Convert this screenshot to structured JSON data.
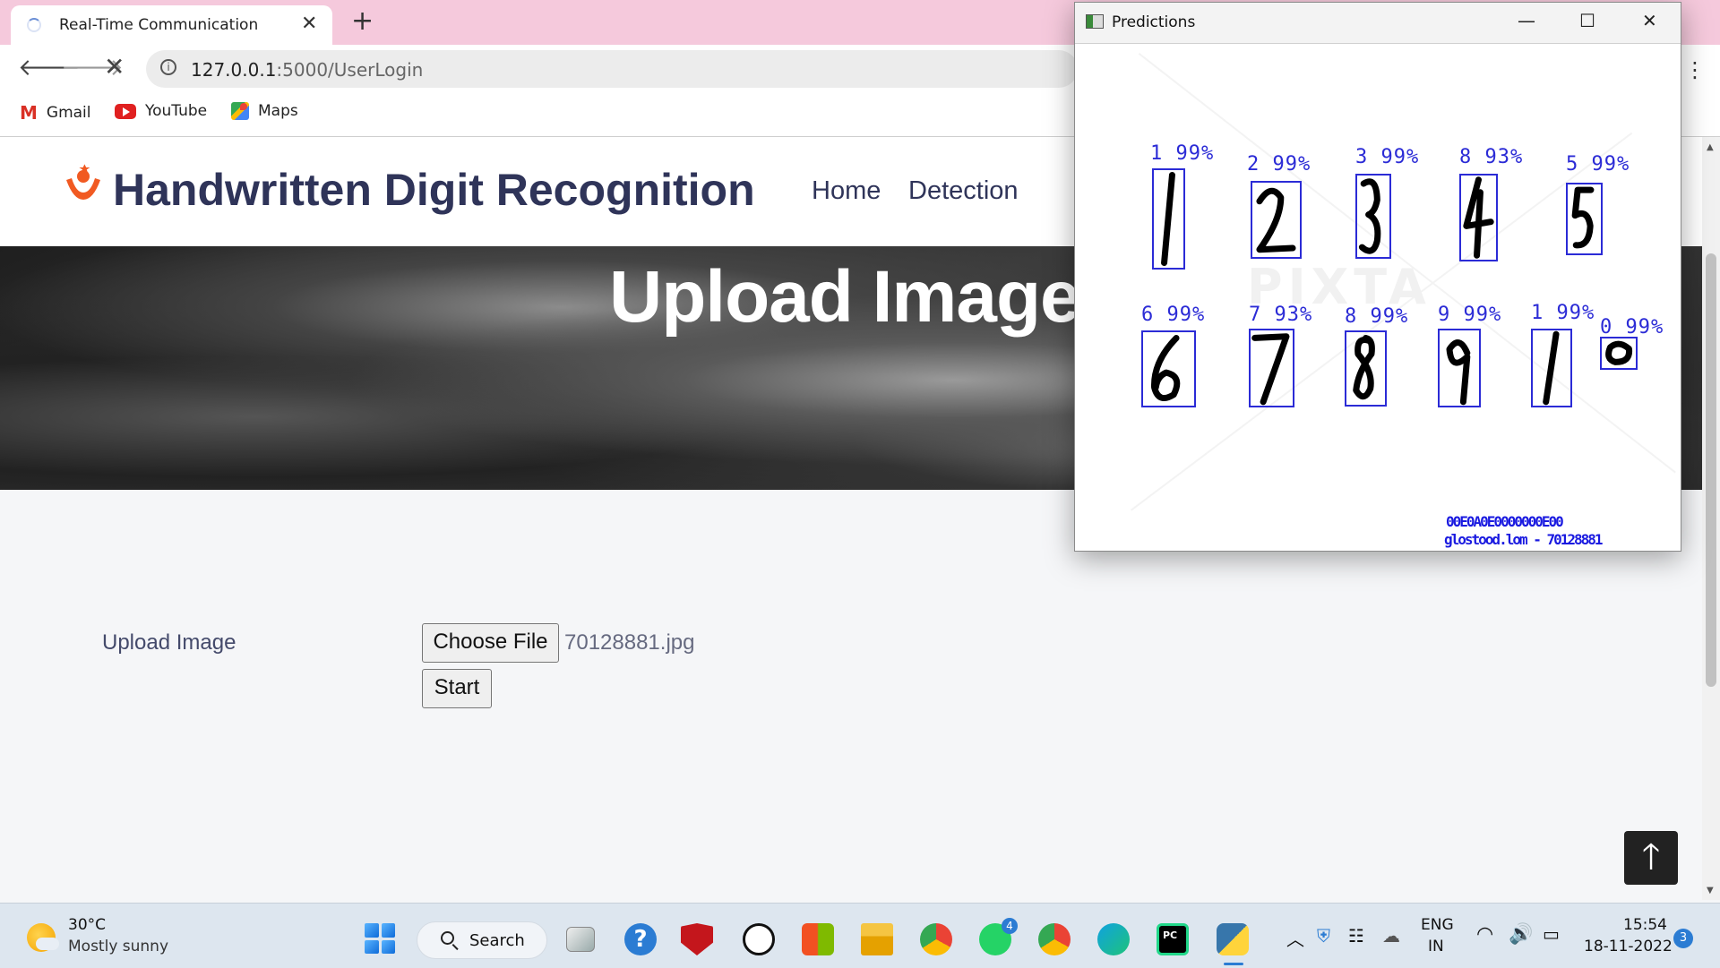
{
  "browser": {
    "tab_title": "Real-Time Communication",
    "tab_close": "✕",
    "new_tab": "+",
    "url_host": "127.0.0.1",
    "url_rest": ":5000/UserLogin",
    "bookmarks": [
      {
        "label": "Gmail",
        "icon": "gmail-icon"
      },
      {
        "label": "YouTube",
        "icon": "youtube-icon"
      },
      {
        "label": "Maps",
        "icon": "maps-icon"
      }
    ]
  },
  "site": {
    "title": "Handwritten Digit Recognition",
    "nav": [
      "Home",
      "Detection"
    ],
    "hero_title": "Upload Image",
    "upload_label": "Upload Image",
    "choose_file_label": "Choose File",
    "file_name": "70128881.jpg",
    "start_label": "Start",
    "to_top": "🡑"
  },
  "predictions_window": {
    "title": "Predictions",
    "watermark": "PIXTA",
    "detections": [
      {
        "digit": "1",
        "label": "1 99%",
        "confidence": 99
      },
      {
        "digit": "2",
        "label": "2 99%",
        "confidence": 99
      },
      {
        "digit": "3",
        "label": "3 99%",
        "confidence": 99
      },
      {
        "digit": "4",
        "label": "8 93%",
        "confidence": 93
      },
      {
        "digit": "5",
        "label": "5 99%",
        "confidence": 99
      },
      {
        "digit": "6",
        "label": "6 99%",
        "confidence": 99
      },
      {
        "digit": "7",
        "label": "7 93%",
        "confidence": 93
      },
      {
        "digit": "8",
        "label": "8 99%",
        "confidence": 99
      },
      {
        "digit": "9",
        "label": "9 99%",
        "confidence": 99
      },
      {
        "digit": "1",
        "label": "1 99%",
        "confidence": 99
      },
      {
        "digit": "0",
        "label": "0 99%",
        "confidence": 99
      }
    ],
    "noise_line_1": "00E0A0E0000000E00",
    "noise_line_2": "glostood.lom - 70128881"
  },
  "taskbar": {
    "temperature": "30°C",
    "weather": "Mostly sunny",
    "search_label": "Search",
    "whatsapp_badge": "4",
    "language_1": "ENG",
    "language_2": "IN",
    "time": "15:54",
    "date": "18-11-2022",
    "notifications": "3"
  }
}
